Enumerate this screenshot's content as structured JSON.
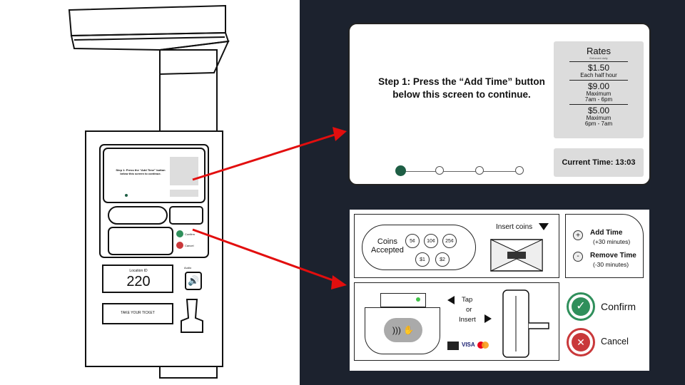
{
  "screen": {
    "step_text": "Step 1: Press the “Add Time” button below this screen to continue.",
    "rates": {
      "title": "Rates",
      "subtitle": "Enforced daily",
      "items": [
        {
          "price": "$1.50",
          "desc": "Each half hour"
        },
        {
          "price": "$9.00",
          "desc": "Maximum\n7am - 6pm"
        },
        {
          "price": "$5.00",
          "desc": "Maximum\n6pm - 7am"
        }
      ]
    },
    "current_time_label": "Current Time: 13:03"
  },
  "coins": {
    "accepted_label": "Coins\nAccepted",
    "values": [
      "5¢",
      "10¢",
      "25¢",
      "$1",
      "$2"
    ],
    "insert_label": "Insert coins"
  },
  "time_controls": {
    "add_label": "Add Time",
    "add_sub": "(+30 minutes)",
    "remove_label": "Remove Time",
    "remove_sub": "(-30 minutes)"
  },
  "payment": {
    "tap_label": "Tap",
    "or_label": "or",
    "insert_label": "Insert",
    "cards": [
      "VISA"
    ]
  },
  "actions": {
    "confirm_label": "Confirm",
    "cancel_label": "Cancel"
  },
  "kiosk": {
    "location_label": "Location ID",
    "location_value": "220",
    "audio_label": "Audio",
    "ticket_label": "TAKE YOUR TICKET",
    "mini_confirm": "Confirm",
    "mini_cancel": "Cancel"
  },
  "colors": {
    "green": "#2f8f5b",
    "red": "#c9383a",
    "dark_bg": "#1c222e",
    "arrow": "#e20e0e"
  }
}
